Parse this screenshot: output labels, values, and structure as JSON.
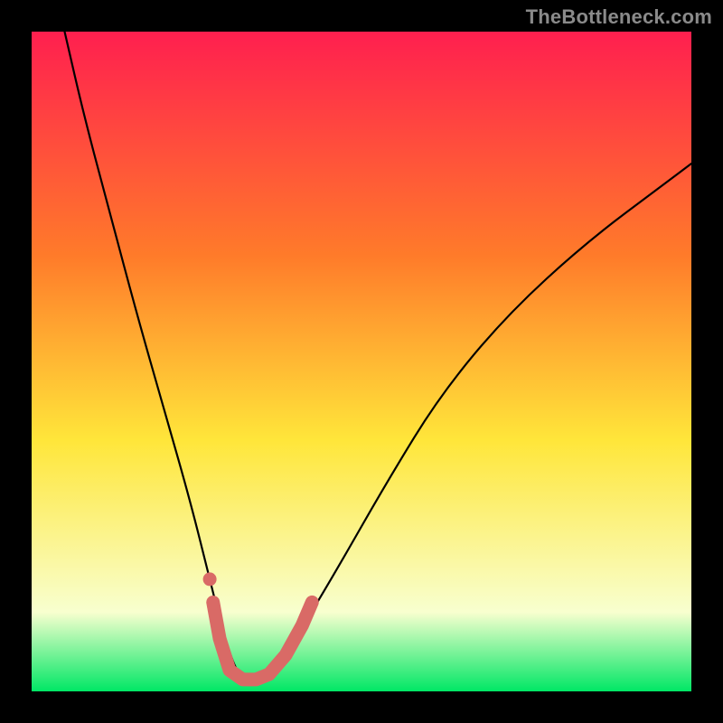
{
  "watermark": "TheBottleneck.com",
  "colors": {
    "frame": "#000000",
    "grad_top": "#ff1f4f",
    "grad_mid1": "#ff7b2a",
    "grad_mid2": "#ffe63a",
    "grad_low": "#f8ffcf",
    "grad_bottom": "#00e765",
    "curve": "#000000",
    "marker": "#d96a66"
  },
  "chart_data": {
    "type": "line",
    "title": "",
    "xlabel": "",
    "ylabel": "",
    "xlim": [
      0,
      100
    ],
    "ylim": [
      0,
      100
    ],
    "series": [
      {
        "name": "bottleneck-curve",
        "x": [
          5,
          8,
          12,
          16,
          20,
          24,
          27,
          29,
          31,
          33,
          35,
          40,
          46,
          54,
          62,
          72,
          84,
          96,
          100
        ],
        "y": [
          100,
          87,
          72,
          57,
          43,
          29,
          17,
          9,
          3,
          1,
          2,
          8,
          18,
          32,
          45,
          57,
          68,
          77,
          80
        ]
      }
    ],
    "markers": {
      "name": "highlight-region",
      "points": [
        {
          "x": 27.5,
          "y": 13.5
        },
        {
          "x": 28.5,
          "y": 8.0
        },
        {
          "x": 30.0,
          "y": 3.2
        },
        {
          "x": 32.0,
          "y": 1.8
        },
        {
          "x": 34.0,
          "y": 1.8
        },
        {
          "x": 36.0,
          "y": 2.6
        },
        {
          "x": 38.5,
          "y": 5.5
        },
        {
          "x": 41.0,
          "y": 10.0
        },
        {
          "x": 42.5,
          "y": 13.5
        }
      ],
      "extra_dot": {
        "x": 27.0,
        "y": 17.0
      }
    }
  }
}
